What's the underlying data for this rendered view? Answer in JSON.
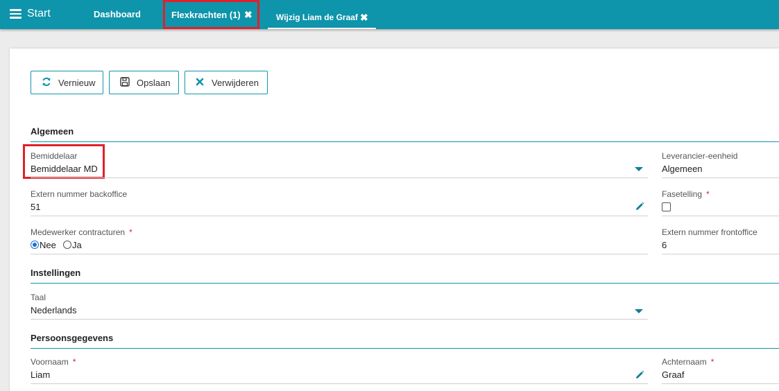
{
  "header": {
    "start_label": "Start",
    "tabs": [
      {
        "label": "Dashboard"
      },
      {
        "label": "Flexkrachten (1)"
      },
      {
        "label": "Wijzig Liam de Graaf"
      }
    ],
    "close_glyph": "✖",
    "menu_icon": "hamburger-icon"
  },
  "toolbar": {
    "refresh_label": "Vernieuw",
    "save_label": "Opslaan",
    "delete_label": "Verwijderen"
  },
  "sections": {
    "algemeen": {
      "title": "Algemeen",
      "bemiddelaar_label": "Bemiddelaar",
      "bemiddelaar_value": "Bemiddelaar MD",
      "leverancier_label": "Leverancier-eenheid",
      "leverancier_value": "Algemeen",
      "extern_backoffice_label": "Extern nummer backoffice",
      "extern_backoffice_value": "51",
      "fasetelling_label": "Fasetelling",
      "fasetelling_checked": false,
      "medewerker_label": "Medewerker contracturen",
      "medewerker_options": [
        "Nee",
        "Ja"
      ],
      "medewerker_selected": "Nee",
      "extern_frontoffice_label": "Extern nummer frontoffice",
      "extern_frontoffice_value": "6"
    },
    "instellingen": {
      "title": "Instellingen",
      "taal_label": "Taal",
      "taal_value": "Nederlands"
    },
    "persoonsgegevens": {
      "title": "Persoonsgegevens",
      "voornaam_label": "Voornaam",
      "voornaam_value": "Liam",
      "achternaam_label": "Achternaam",
      "achternaam_value": "Graaf"
    }
  },
  "required_marker": "*",
  "colors": {
    "accent": "#0e94ab",
    "highlight": "#e0202a",
    "required": "#e0202a"
  }
}
